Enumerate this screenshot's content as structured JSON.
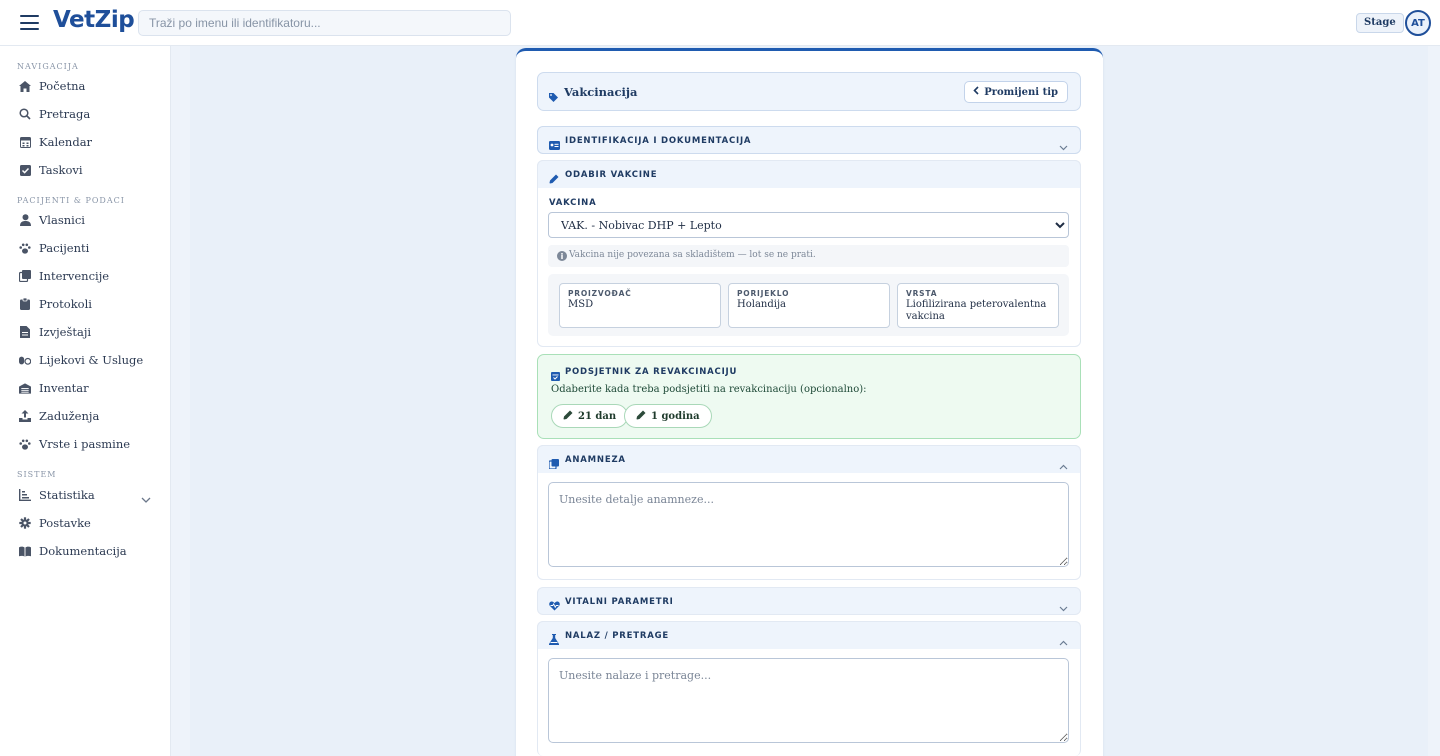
{
  "app": {
    "logo": "VetZip",
    "env_badge": "Stage",
    "user_initials": "AT"
  },
  "search": {
    "placeholder": "Traži po imenu ili identifikatoru..."
  },
  "sidebar": {
    "sections": [
      {
        "title": "NAVIGACIJA",
        "items": [
          {
            "label": "Početna",
            "icon": "home-icon"
          },
          {
            "label": "Pretraga",
            "icon": "search-icon"
          },
          {
            "label": "Kalendar",
            "icon": "calendar-icon"
          },
          {
            "label": "Taskovi",
            "icon": "check-square-icon"
          }
        ]
      },
      {
        "title": "PACIJENTI & PODACI",
        "items": [
          {
            "label": "Vlasnici",
            "icon": "user-icon"
          },
          {
            "label": "Pacijenti",
            "icon": "paw-icon"
          },
          {
            "label": "Intervencije",
            "icon": "clipboard-stack-icon"
          },
          {
            "label": "Protokoli",
            "icon": "clipboard-icon"
          },
          {
            "label": "Izvještaji",
            "icon": "file-icon"
          },
          {
            "label": "Lijekovi & Usluge",
            "icon": "pills-icon"
          },
          {
            "label": "Inventar",
            "icon": "warehouse-icon"
          },
          {
            "label": "Zaduženja",
            "icon": "upload-icon"
          },
          {
            "label": "Vrste i pasmine",
            "icon": "paw-icon"
          }
        ]
      },
      {
        "title": "SISTEM",
        "items": [
          {
            "label": "Statistika",
            "icon": "chart-icon"
          },
          {
            "label": "Postavke",
            "icon": "gear-icon"
          },
          {
            "label": "Dokumentacija",
            "icon": "book-icon"
          }
        ]
      }
    ]
  },
  "form": {
    "type_title": "Vakcinacija",
    "change_type_label": "Promijeni tip",
    "sections": {
      "identification": "IDENTIFIKACIJA I DOKUMENTACIJA",
      "vaccine_select": "ODABIR VAKCINE",
      "anamnesis": "ANAMNEZA",
      "vitals": "VITALNI PARAMETRI",
      "findings": "NALAZ / PRETRAGE"
    },
    "vaccine": {
      "field_label": "VAKCINA",
      "selected": "VAK. - Nobivac DHP + Lepto",
      "info": "Vakcina nije povezana sa skladištem — lot se ne prati.",
      "meta": [
        {
          "key": "PROIZVOĐAČ",
          "value": "MSD"
        },
        {
          "key": "PORIJEKLO",
          "value": "Holandija"
        },
        {
          "key": "VRSTA",
          "value": "Liofilizirana peterovalentna vakcina"
        }
      ]
    },
    "reminder": {
      "title": "PODSJETNIK ZA REVAKCINACIJU",
      "description": "Odaberite kada treba podsjetiti na revakcinaciju (opcionalno):",
      "options": [
        "21 dan",
        "1 godina"
      ]
    },
    "anamnesis_placeholder": "Unesite detalje anamneze...",
    "findings_placeholder": "Unesite nalaze i pretrage..."
  },
  "colors": {
    "accent": "#1f5bb0",
    "success_bg": "#eefaf1",
    "section_bg": "#eef4fc"
  }
}
